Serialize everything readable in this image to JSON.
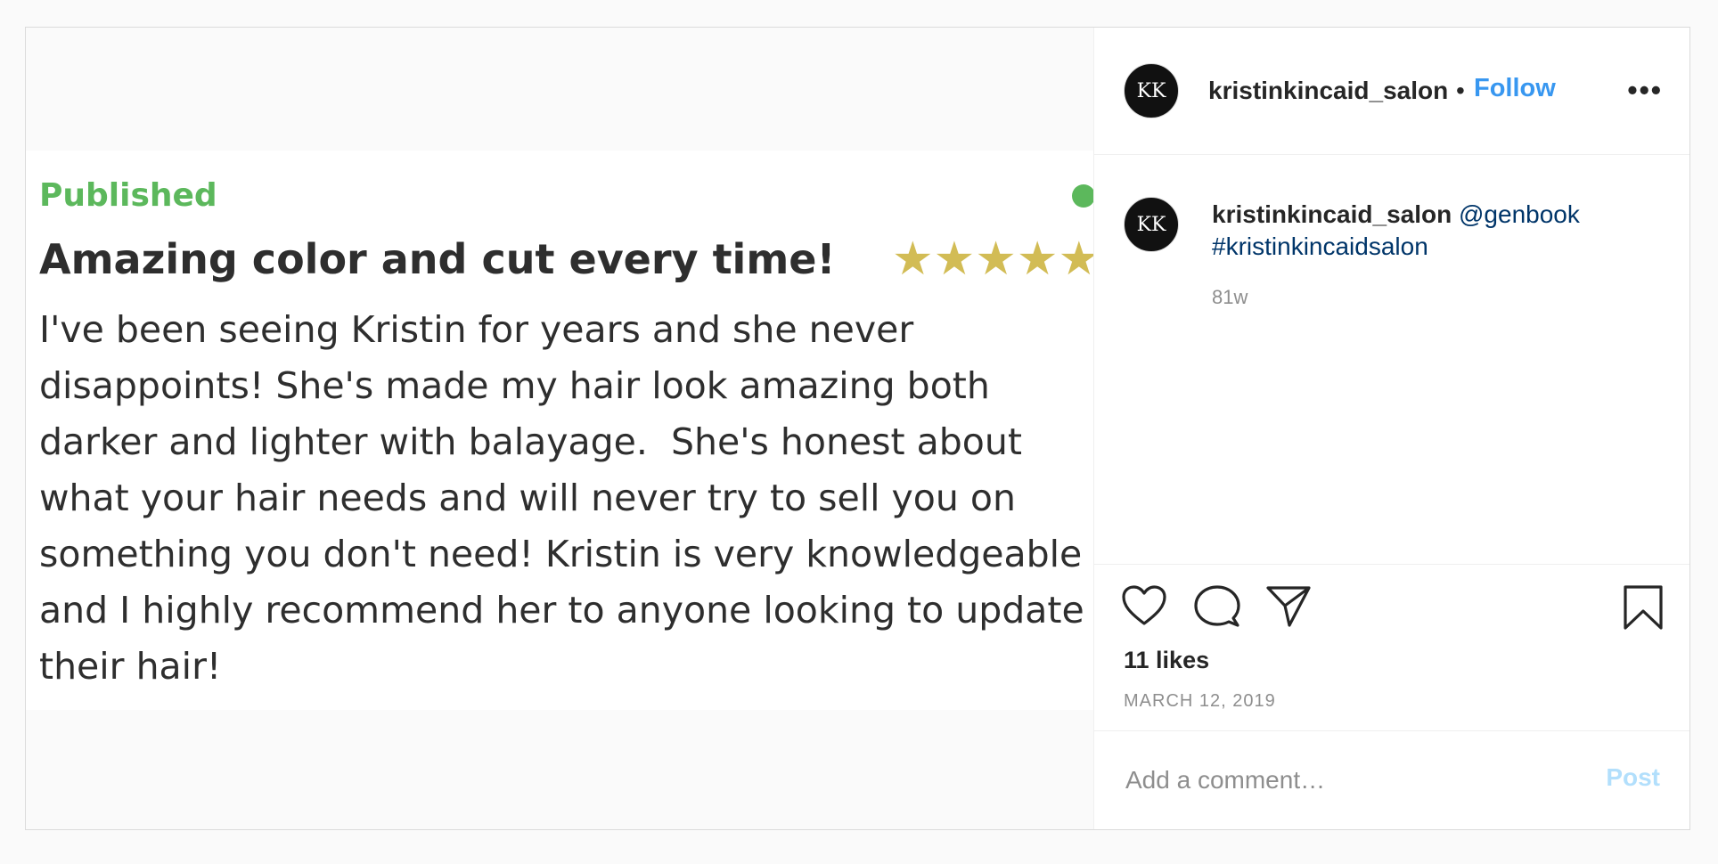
{
  "review": {
    "status": "Published",
    "title": "Amazing color and cut every time!",
    "stars": "★★★★★",
    "body": "I've been seeing Kristin for years and she never disappoints! She's made my hair look amazing both darker and lighter with balayage.  She's honest about what your hair needs and will never try to sell you on something you don't need! Kristin is very knowledgeable and I highly recommend her to anyone looking to update their hair!"
  },
  "header": {
    "avatar_text": "KK",
    "username": "kristinkincaid_salon",
    "separator": "•",
    "follow_label": "Follow",
    "more_label": "•••"
  },
  "caption": {
    "avatar_text": "KK",
    "username": "kristinkincaid_salon",
    "mention": "@genbook",
    "hashtag": "#kristinkincaidsalon",
    "age": "81w"
  },
  "stats": {
    "likes": "11 likes",
    "date": "MARCH 12, 2019"
  },
  "comment": {
    "placeholder": "Add a comment…",
    "post_label": "Post"
  },
  "colors": {
    "accent": "#3897f0",
    "published_green": "#5cb85c",
    "star_gold": "#d2bc55"
  }
}
